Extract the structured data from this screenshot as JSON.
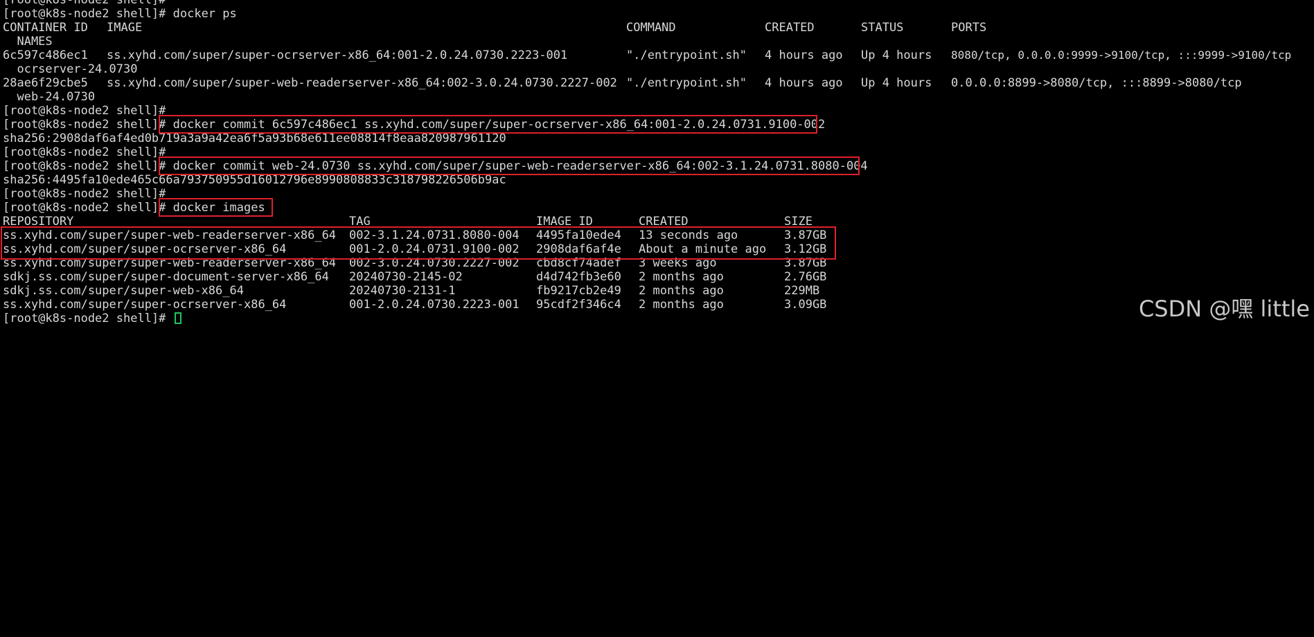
{
  "lines": {
    "l0": "[root@k8s-node2 shell]#",
    "l1": "[root@k8s-node2 shell]# docker ps",
    "ps_header": [
      "CONTAINER ID",
      "IMAGE",
      "COMMAND",
      "CREATED",
      "STATUS",
      "PORTS"
    ],
    "ps_header_names": "  NAMES",
    "ps_rows": [
      {
        "id": "6c597c486ec1",
        "image": "ss.xyhd.com/super/super-ocrserver-x86_64:001-2.0.24.0730.2223-001",
        "command": "\"./entrypoint.sh\"",
        "created": "4 hours ago",
        "status": "Up 4 hours",
        "ports": "8080/tcp, 0.0.0.0:9999->9100/tcp, :::9999->9100/tcp",
        "name": "  ocrserver-24.0730"
      },
      {
        "id": "28ae6f29cbe5",
        "image": "ss.xyhd.com/super/super-web-readerserver-x86_64:002-3.0.24.0730.2227-002",
        "command": "\"./entrypoint.sh\"",
        "created": "4 hours ago",
        "status": "Up 4 hours",
        "ports": "0.0.0.0:8899->8080/tcp, :::8899->8080/tcp",
        "name": "  web-24.0730"
      }
    ],
    "l7": "[root@k8s-node2 shell]#",
    "prompt": "[root@k8s-node2 shell]#",
    "cmd_commit1": " docker commit 6c597c486ec1 ss.xyhd.com/super/super-ocrserver-x86_64:001-2.0.24.0731.9100-002",
    "sha1": "sha256:2908daf6af4ed0b719a3a9a42ea6f5a93b68e611ee08814f8eaa820987961120",
    "l10": "[root@k8s-node2 shell]#",
    "cmd_commit2": " docker commit web-24.0730 ss.xyhd.com/super/super-web-readerserver-x86_64:002-3.1.24.0731.8080-004",
    "sha2": "sha256:4495fa10ede465c66a793750955d16012796e8990808833c318798226506b9ac",
    "l13": "[root@k8s-node2 shell]#",
    "cmd_images": " docker images",
    "img_header": [
      "REPOSITORY",
      "TAG",
      "IMAGE ID",
      "CREATED",
      "SIZE"
    ],
    "img_rows": [
      {
        "repo": "ss.xyhd.com/super/super-web-readerserver-x86_64",
        "tag": "002-3.1.24.0731.8080-004",
        "id": "4495fa10ede4",
        "created": "13 seconds ago",
        "size": "3.87GB"
      },
      {
        "repo": "ss.xyhd.com/super/super-ocrserver-x86_64",
        "tag": "001-2.0.24.0731.9100-002",
        "id": "2908daf6af4e",
        "created": "About a minute ago",
        "size": "3.12GB"
      },
      {
        "repo": "ss.xyhd.com/super/super-web-readerserver-x86_64",
        "tag": "002-3.0.24.0730.2227-002",
        "id": "cbd8cf74adef",
        "created": "3 weeks ago",
        "size": "3.87GB"
      },
      {
        "repo": "sdkj.ss.com/super/super-document-server-x86_64",
        "tag": "20240730-2145-02",
        "id": "d4d742fb3e60",
        "created": "2 months ago",
        "size": "2.76GB"
      },
      {
        "repo": "sdkj.ss.com/super/super-web-x86_64",
        "tag": "20240730-2131-1",
        "id": "fb9217cb2e49",
        "created": "2 months ago",
        "size": "229MB"
      },
      {
        "repo": "ss.xyhd.com/super/super-ocrserver-x86_64",
        "tag": "001-2.0.24.0730.2223-001",
        "id": "95cdf2f346c4",
        "created": "2 months ago",
        "size": "3.09GB"
      }
    ],
    "last_prompt": "[root@k8s-node2 shell]# "
  },
  "watermark": "CSDN @嘿 little",
  "colors": {
    "background": "#000000",
    "text": "#d8d8d8",
    "highlight_box": "#e0202a",
    "cursor": "#22c55e"
  }
}
